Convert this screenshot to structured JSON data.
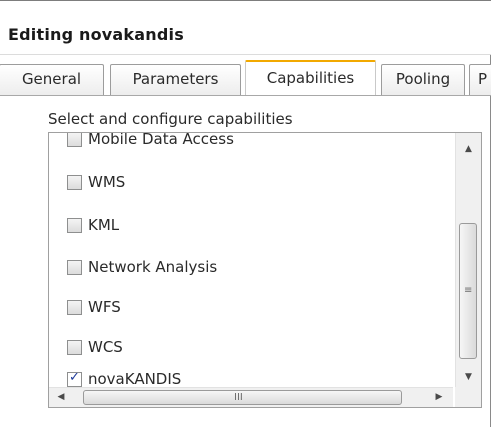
{
  "window": {
    "title": "Editing novakandis"
  },
  "tabs": [
    {
      "label": "General",
      "active": false
    },
    {
      "label": "Parameters",
      "active": false
    },
    {
      "label": "Capabilities",
      "active": true
    },
    {
      "label": "Pooling",
      "active": false
    },
    {
      "label": "P",
      "active": false
    }
  ],
  "capabilities": {
    "instruction": "Select and configure capabilities",
    "items": [
      {
        "label": "Mobile Data Access",
        "checked": false
      },
      {
        "label": "WMS",
        "checked": false
      },
      {
        "label": "KML",
        "checked": false
      },
      {
        "label": "Network Analysis",
        "checked": false
      },
      {
        "label": "WFS",
        "checked": false
      },
      {
        "label": "WCS",
        "checked": false
      },
      {
        "label": "novaKANDIS",
        "checked": true
      }
    ]
  },
  "scrollbars": {
    "vertical_grip": "≡",
    "horizontal_grip": "III",
    "up_icon": "▲",
    "down_icon": "▼",
    "left_icon": "◀",
    "right_icon": "▶"
  },
  "colors": {
    "active_tab_accent": "#f2a900",
    "checkmark": "#1f3b9b"
  }
}
